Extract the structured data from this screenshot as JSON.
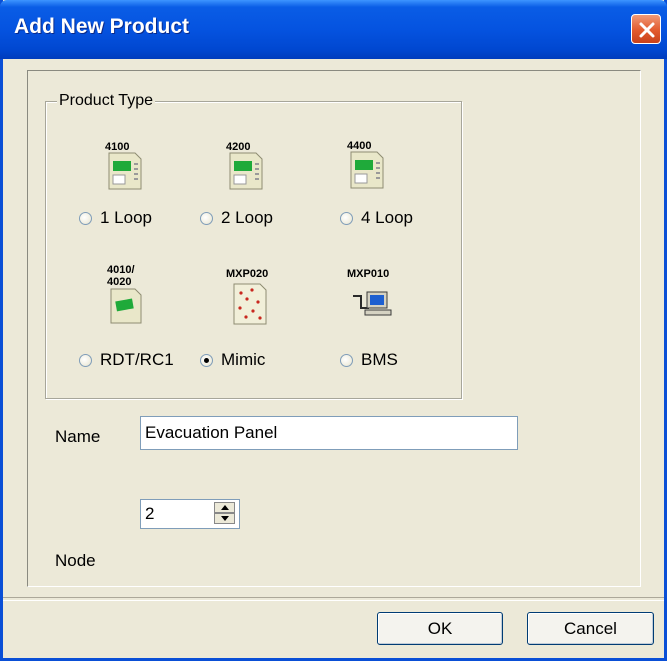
{
  "window": {
    "title": "Add New Product"
  },
  "product_type": {
    "legend": "Product Type",
    "items": [
      {
        "icon_label": "4100",
        "icon": "panel-4100-icon",
        "radio_label": "1 Loop",
        "checked": false
      },
      {
        "icon_label": "4200",
        "icon": "panel-4200-icon",
        "radio_label": "2 Loop",
        "checked": false
      },
      {
        "icon_label": "4400",
        "icon": "panel-4400-icon",
        "radio_label": "4 Loop",
        "checked": false
      },
      {
        "icon_label": "4010/\n4020",
        "icon": "rdt-4010-4020-icon",
        "radio_label": "RDT/RC1",
        "checked": false
      },
      {
        "icon_label": "MXP020",
        "icon": "mimic-mxp020-icon",
        "radio_label": "Mimic",
        "checked": true
      },
      {
        "icon_label": "MXP010",
        "icon": "bms-mxp010-icon",
        "radio_label": "BMS",
        "checked": false
      }
    ]
  },
  "form": {
    "name_label": "Name",
    "name_value": "Evacuation Panel",
    "node_label": "Node",
    "node_value": "2"
  },
  "buttons": {
    "ok": "OK",
    "cancel": "Cancel"
  },
  "colors": {
    "titlebar": "#0553e0",
    "dialog_bg": "#ece9d8",
    "close": "#e25a2e"
  }
}
